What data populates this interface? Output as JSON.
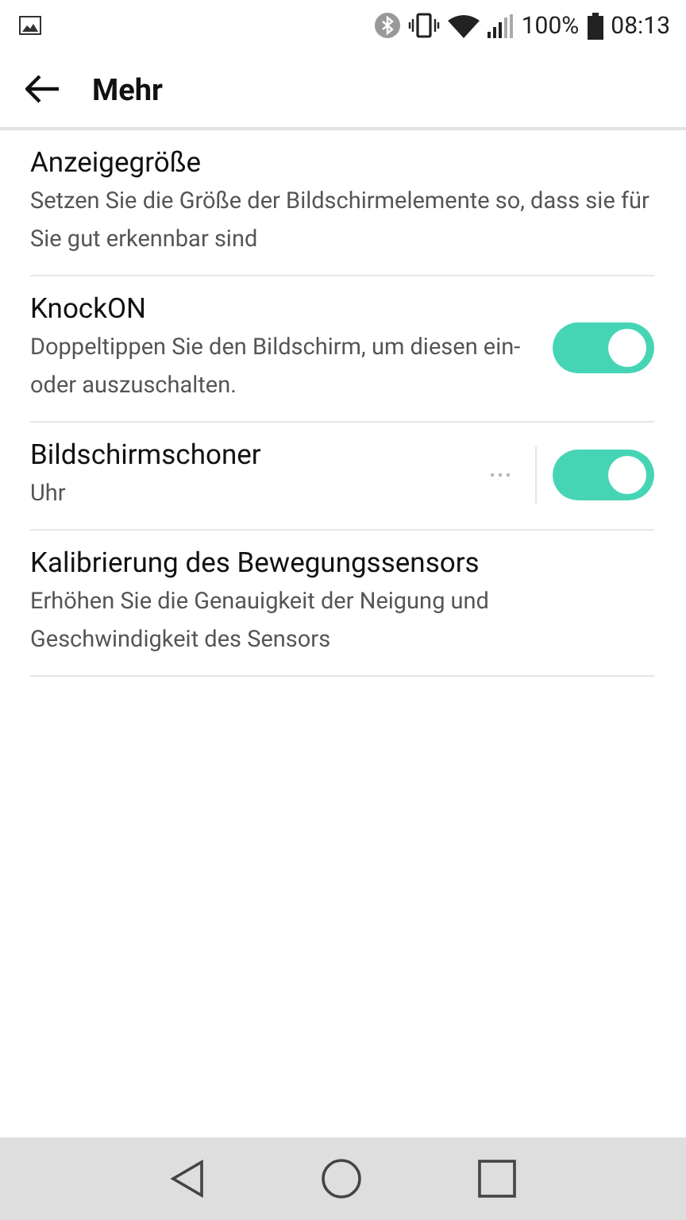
{
  "status_bar": {
    "battery": "100%",
    "time": "08:13"
  },
  "app_bar": {
    "title": "Mehr"
  },
  "settings": [
    {
      "kind": "text",
      "title": "Anzeigegröße",
      "summary": "Setzen Sie die Größe der Bildschirmelemente so, dass sie für Sie gut erkennbar sind"
    },
    {
      "kind": "toggle",
      "title": "KnockON",
      "summary": "Doppeltippen Sie den Bildschirm, um diesen ein- oder auszuschalten.",
      "on": true
    },
    {
      "kind": "toggle_more",
      "title": "Bildschirmschoner",
      "summary": "Uhr",
      "on": true
    },
    {
      "kind": "text",
      "title": "Kalibrierung des Bewegungssensors",
      "summary": "Erhöhen Sie die Genauigkeit der Neigung und Geschwindigkeit des Sensors"
    }
  ]
}
